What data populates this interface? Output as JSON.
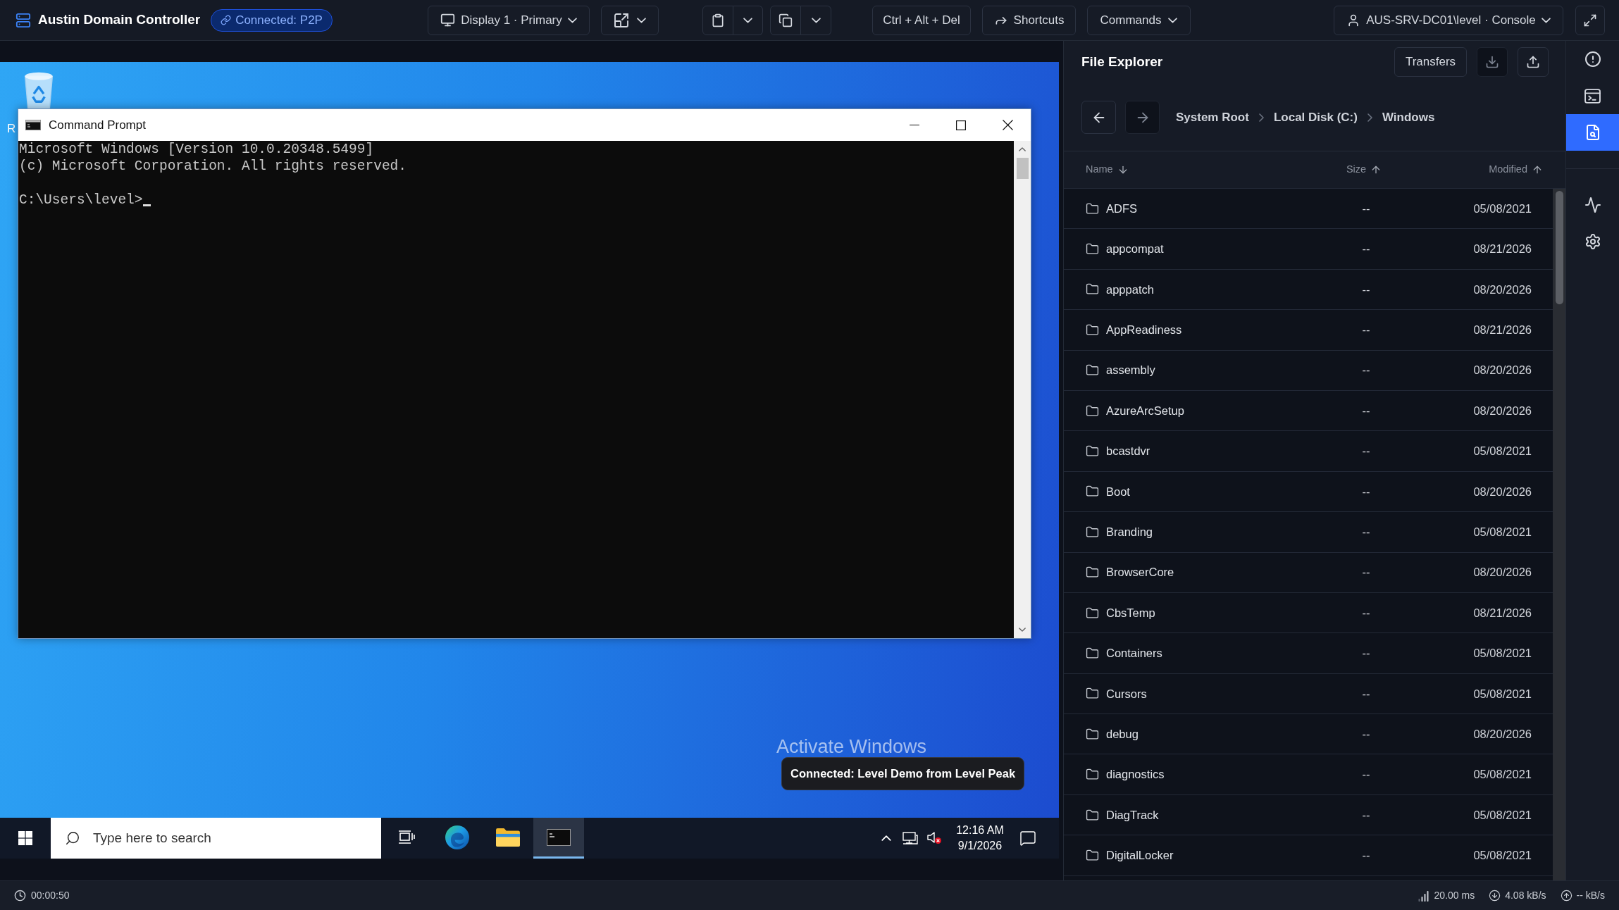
{
  "toolbar": {
    "server_name": "Austin Domain Controller",
    "connection_badge": "Connected: P2P",
    "display_button": "Display 1 · Primary",
    "ctrl_alt_del_button": "Ctrl + Alt + Del",
    "shortcuts_button": "Shortcuts",
    "commands_button": "Commands",
    "session_button": "AUS-SRV-DC01\\level · Console"
  },
  "remote_desktop": {
    "desktop_icon_label": "R",
    "command_prompt": {
      "title": "Command Prompt",
      "output_lines": [
        "Microsoft Windows [Version 10.0.20348.5499]",
        "(c) Microsoft Corporation. All rights reserved."
      ],
      "prompt": "C:\\Users\\level>"
    },
    "activation_notice": "Activate Windows",
    "toast": "Connected: Level Demo from Level Peak",
    "taskbar": {
      "search_placeholder": "Type here to search",
      "apps": [
        {
          "kind": "task-view",
          "selected": false
        },
        {
          "kind": "browser",
          "selected": false
        },
        {
          "kind": "folder",
          "selected": false
        },
        {
          "kind": "terminal",
          "selected": true
        }
      ],
      "sound_muted": true,
      "clock_time": "12:16 AM",
      "clock_date": "9/1/2026"
    }
  },
  "file_explorer": {
    "title": "File Explorer",
    "transfers_button": "Transfers",
    "actions": [
      {
        "kind": "download",
        "disabled": true
      },
      {
        "kind": "upload",
        "disabled": false
      }
    ],
    "nav": [
      {
        "kind": "back",
        "disabled": false
      },
      {
        "kind": "forward",
        "disabled": true
      }
    ],
    "breadcrumb": [
      "System Root",
      "Local Disk (C:)",
      "Windows"
    ],
    "columns": [
      {
        "label": "Name",
        "ascending": false
      },
      {
        "label": "Size",
        "ascending": true
      },
      {
        "label": "Modified",
        "ascending": true
      }
    ],
    "rows": [
      {
        "name": "ADFS",
        "size": "--",
        "modified": "05/08/2021"
      },
      {
        "name": "appcompat",
        "size": "--",
        "modified": "08/21/2026"
      },
      {
        "name": "apppatch",
        "size": "--",
        "modified": "08/20/2026"
      },
      {
        "name": "AppReadiness",
        "size": "--",
        "modified": "08/21/2026"
      },
      {
        "name": "assembly",
        "size": "--",
        "modified": "08/20/2026"
      },
      {
        "name": "AzureArcSetup",
        "size": "--",
        "modified": "08/20/2026"
      },
      {
        "name": "bcastdvr",
        "size": "--",
        "modified": "05/08/2021"
      },
      {
        "name": "Boot",
        "size": "--",
        "modified": "08/20/2026"
      },
      {
        "name": "Branding",
        "size": "--",
        "modified": "05/08/2021"
      },
      {
        "name": "BrowserCore",
        "size": "--",
        "modified": "08/20/2026"
      },
      {
        "name": "CbsTemp",
        "size": "--",
        "modified": "08/21/2026"
      },
      {
        "name": "Containers",
        "size": "--",
        "modified": "05/08/2021"
      },
      {
        "name": "Cursors",
        "size": "--",
        "modified": "05/08/2021"
      },
      {
        "name": "debug",
        "size": "--",
        "modified": "08/20/2026"
      },
      {
        "name": "diagnostics",
        "size": "--",
        "modified": "05/08/2021"
      },
      {
        "name": "DiagTrack",
        "size": "--",
        "modified": "05/08/2021"
      },
      {
        "name": "DigitalLocker",
        "size": "--",
        "modified": "05/08/2021"
      }
    ]
  },
  "side_rail": {
    "items": [
      {
        "kind": "alert",
        "selected": false
      },
      {
        "kind": "terminal",
        "selected": false
      },
      {
        "kind": "file-search",
        "selected": true
      },
      {
        "kind": "activity",
        "selected": false
      },
      {
        "kind": "settings",
        "selected": false
      }
    ]
  },
  "status_bar": {
    "session_time": "00:00:50",
    "latency": "20.00 ms",
    "download_rate": "4.08 kB/s",
    "upload_rate": "-- kB/s"
  }
}
